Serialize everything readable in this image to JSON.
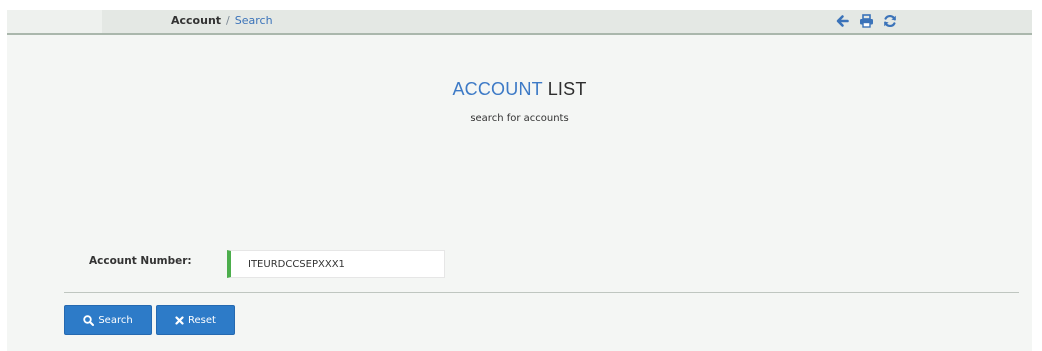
{
  "breadcrumb": {
    "root": "Account",
    "separator": "/",
    "current": "Search"
  },
  "toolbar": {
    "icons": [
      "arrow-left-icon",
      "print-icon",
      "refresh-icon"
    ],
    "icon_color": "#3b73b9"
  },
  "page": {
    "title_accent": "ACCOUNT",
    "title_rest": "LIST",
    "subtitle": "search for accounts"
  },
  "form": {
    "account_number_label": "Account Number:",
    "account_number_value": "ITEURDCCSEPXXX1",
    "valid_indicator_color": "#4cae4c"
  },
  "actions": {
    "search_label": "Search",
    "reset_label": "Reset",
    "button_color": "#2d7bc8"
  }
}
